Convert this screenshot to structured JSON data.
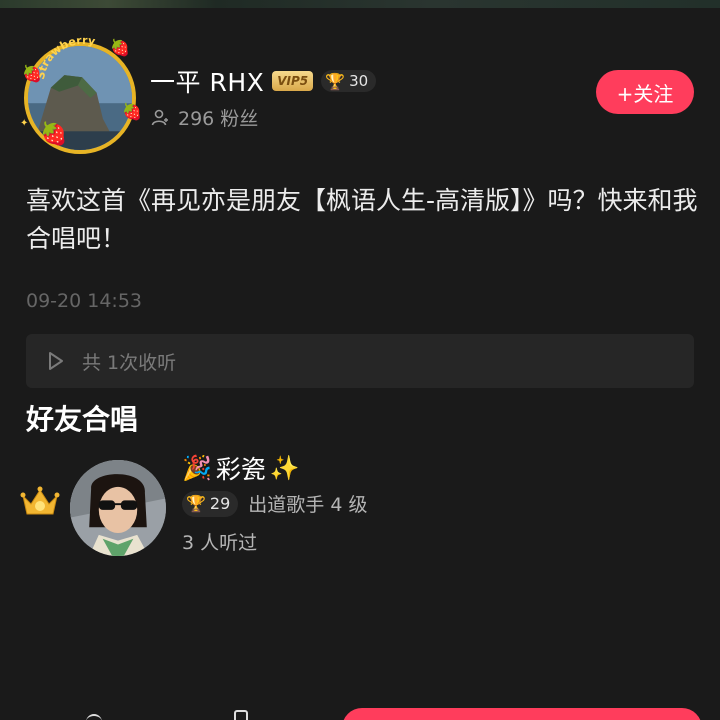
{
  "profile": {
    "badge_text": "Strawberry",
    "username": "一平 RHX",
    "vip_label": "VIP5",
    "trophy_count": "30",
    "fans_label": "296 粉丝",
    "follow_label": "+关注"
  },
  "post": {
    "description": "喜欢这首《再见亦是朋友【枫语人生-高清版】》吗？快来和我合唱吧！",
    "timestamp": "09-20 14:53",
    "listen_label": "共 1次收听"
  },
  "duet_section": {
    "title": "好友合唱",
    "friends": [
      {
        "name": "彩瓷",
        "name_prefix_emoji": "🎉",
        "name_suffix_emoji": "✨",
        "trophy_count": "29",
        "level_label": "出道歌手 4 级",
        "listen_label": "3 人听过"
      }
    ]
  },
  "colors": {
    "accent": "#ff3d5c",
    "gold": "#e7b425",
    "background": "#1a1a1a",
    "panel": "#262626"
  },
  "icons": {
    "trophy": "trophy-icon",
    "fans": "person-icon",
    "play": "play-icon",
    "crown": "crown-icon",
    "vip": "vip-badge-icon"
  }
}
